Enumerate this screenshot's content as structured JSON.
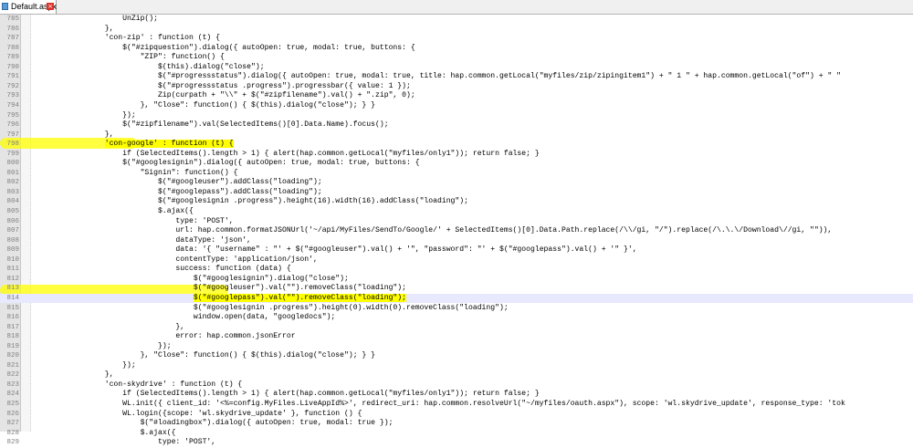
{
  "tab": {
    "file_name": "Default.aspx",
    "icon": "file-icon",
    "close": "×"
  },
  "colors": {
    "highlight": "#ffff00",
    "current_line": "#e8e8ff",
    "line_number": "#808080"
  },
  "current_line": "814",
  "lines": [
    {
      "n": "785",
      "code": "                    UnZip();"
    },
    {
      "n": "786",
      "code": "                },",
      "hl": ""
    },
    {
      "n": "787",
      "code": "                'con-zip' : function (t) {"
    },
    {
      "n": "788",
      "code": "                    $(\"#zipquestion\").dialog({ autoOpen: true, modal: true, buttons: {"
    },
    {
      "n": "789",
      "code": "                        \"ZIP\": function() {"
    },
    {
      "n": "790",
      "code": "                            $(this).dialog(\"close\");"
    },
    {
      "n": "791",
      "code": "                            $(\"#progressstatus\").dialog({ autoOpen: true, modal: true, title: hap.common.getLocal(\"myfiles/zip/zipingitem1\") + \" 1 \" + hap.common.getLocal(\"of\") + \" \""
    },
    {
      "n": "792",
      "code": "                            $(\"#progressstatus .progress\").progressbar({ value: 1 });"
    },
    {
      "n": "793",
      "code": "                            Zip(curpath + \"\\\\\" + $(\"#zipfilename\").val() + \".zip\", 0);"
    },
    {
      "n": "794",
      "code": "                        }, \"Close\": function() { $(this).dialog(\"close\"); } }"
    },
    {
      "n": "795",
      "code": "                    });"
    },
    {
      "n": "796",
      "code": "                    $(\"#zipfilename\").val(SelectedItems()[0].Data.Name).focus();"
    },
    {
      "n": "797",
      "code": "                },"
    },
    {
      "n": "798",
      "code": "                'con-google' : function (t) {",
      "hl": "'con-google' : function (t) {"
    },
    {
      "n": "799",
      "code": "                    if (SelectedItems().length > 1) { alert(hap.common.getLocal(\"myfiles/only1\")); return false; }"
    },
    {
      "n": "800",
      "code": "                    $(\"#googlesignin\").dialog({ autoOpen: true, modal: true, buttons: {"
    },
    {
      "n": "801",
      "code": "                        \"Signin\": function() {"
    },
    {
      "n": "802",
      "code": "                            $(\"#googleuser\").addClass(\"loading\");"
    },
    {
      "n": "803",
      "code": "                            $(\"#googlepass\").addClass(\"loading\");"
    },
    {
      "n": "804",
      "code": "                            $(\"#googlesignin .progress\").height(16).width(16).addClass(\"loading\");"
    },
    {
      "n": "805",
      "code": "                            $.ajax({"
    },
    {
      "n": "806",
      "code": "                                type: 'POST',"
    },
    {
      "n": "807",
      "code": "                                url: hap.common.formatJSONUrl('~/api/MyFiles/SendTo/Google/' + SelectedItems()[0].Data.Path.replace(/\\\\/gi, \"/\").replace(/\\.\\.\\/Download\\//gi, \"\")),"
    },
    {
      "n": "808",
      "code": "                                dataType: 'json',"
    },
    {
      "n": "809",
      "code": "                                data: '{ \"username\" : \"' + $(\"#googleuser\").val() + '\", \"password\": \"' + $(\"#googlepass\").val() + '\" }',"
    },
    {
      "n": "810",
      "code": "                                contentType: 'application/json',"
    },
    {
      "n": "811",
      "code": "                                success: function (data) {"
    },
    {
      "n": "812",
      "code": "                                    $(\"#googlesignin\").dialog(\"close\");"
    },
    {
      "n": "813",
      "code": "                                    $(\"#googleuser\").val(\"\").removeClass(\"loading\");"
    },
    {
      "n": "814",
      "code": "                                    $(\"#googlepass\").val(\"\").removeClass(\"loading\");",
      "hl": "$(\"#googlepass\").val(\"\").removeClass(\"loading\");"
    },
    {
      "n": "815",
      "code": "                                    $(\"#googlesignin .progress\").height(0).width(0).removeClass(\"loading\");"
    },
    {
      "n": "816",
      "code": "                                    window.open(data, \"googledocs\");"
    },
    {
      "n": "817",
      "code": "                                },"
    },
    {
      "n": "818",
      "code": "                                error: hap.common.jsonError"
    },
    {
      "n": "819",
      "code": "                            });"
    },
    {
      "n": "820",
      "code": "                        }, \"Close\": function() { $(this).dialog(\"close\"); } }"
    },
    {
      "n": "821",
      "code": "                    });"
    },
    {
      "n": "822",
      "code": "                },"
    },
    {
      "n": "823",
      "code": "                'con-skydrive' : function (t) {"
    },
    {
      "n": "824",
      "code": "                    if (SelectedItems().length > 1) { alert(hap.common.getLocal(\"myfiles/only1\")); return false; }"
    },
    {
      "n": "825",
      "code": "                    WL.init({ client_id: '<%=config.MyFiles.LiveAppId%>', redirect_uri: hap.common.resolveUrl(\"~/myfiles/oauth.aspx\"), scope: 'wl.skydrive_update', response_type: 'tok"
    },
    {
      "n": "826",
      "code": "                    WL.login({scope: 'wl.skydrive_update' }, function () {"
    },
    {
      "n": "827",
      "code": "                        $(\"#loadingbox\").dialog({ autoOpen: true, modal: true });"
    },
    {
      "n": "828",
      "code": "                        $.ajax({"
    },
    {
      "n": "829",
      "code": "                            type: 'POST',"
    }
  ]
}
